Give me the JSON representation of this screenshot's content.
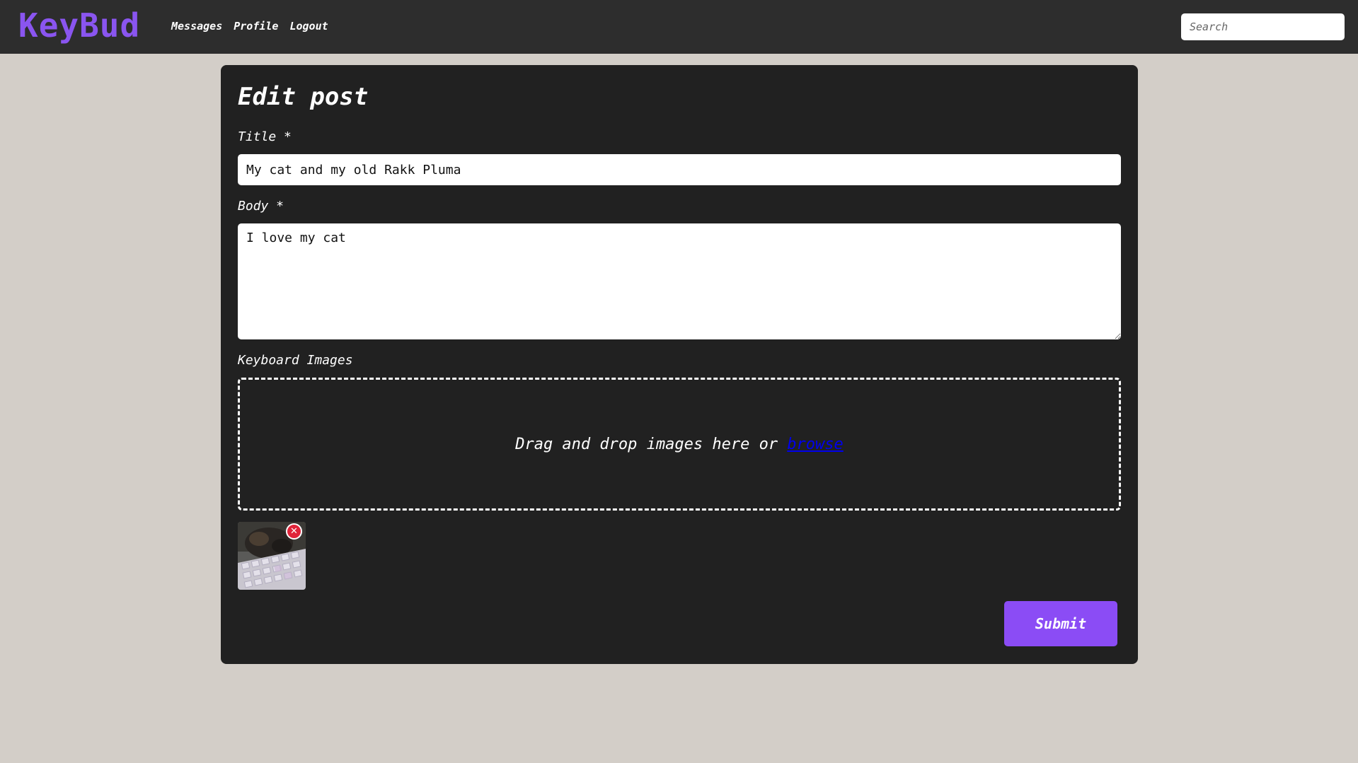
{
  "app": {
    "brand": "KeyBud",
    "accent_color": "#8a55f0",
    "submit_color": "#8b4cf5",
    "background_color": "#d3cec8",
    "nav_color": "#2d2d2d",
    "card_color": "#212121"
  },
  "nav": {
    "links": [
      {
        "label": "Messages"
      },
      {
        "label": "Profile"
      },
      {
        "label": "Logout"
      }
    ],
    "search": {
      "placeholder": "Search",
      "value": ""
    }
  },
  "form": {
    "heading": "Edit post",
    "title": {
      "label": "Title *",
      "value": "My cat and my old Rakk Pluma"
    },
    "body": {
      "label": "Body *",
      "value": "I love my cat"
    },
    "images": {
      "label": "Keyboard Images",
      "dropzone_text": "Drag and drop images here or ",
      "browse_label": "browse",
      "remove_icon": "close-icon",
      "remove_symbol": "✕",
      "thumbnails": [
        {
          "alt": "cat and keyboard photo"
        }
      ]
    },
    "submit_label": "Submit"
  }
}
